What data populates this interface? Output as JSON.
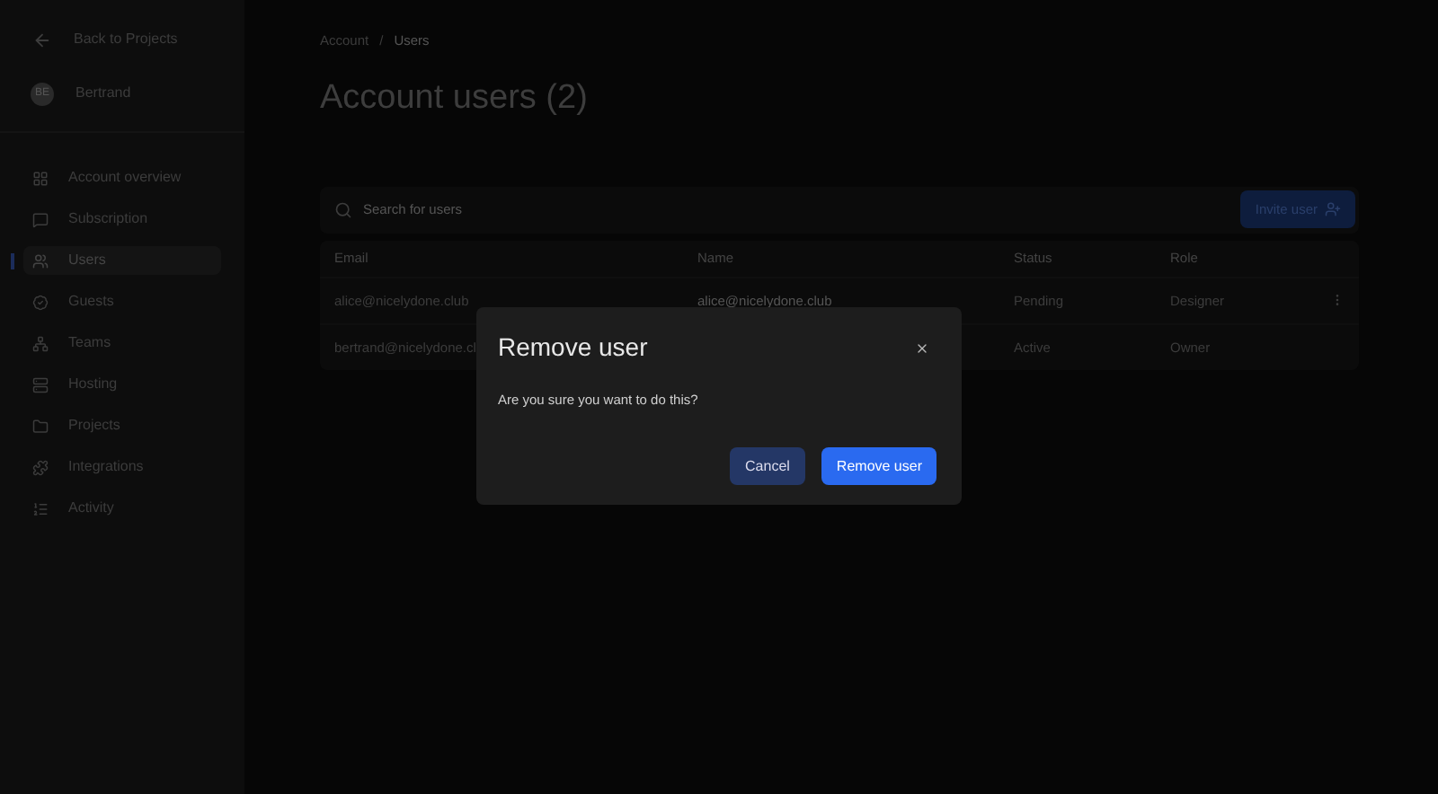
{
  "sidebar": {
    "back_link": "Back to Projects",
    "user": {
      "initials": "BE",
      "name": "Bertrand"
    },
    "items": [
      {
        "label": "Account overview",
        "selected": false
      },
      {
        "label": "Subscription",
        "selected": false
      },
      {
        "label": "Users",
        "selected": true
      },
      {
        "label": "Guests",
        "selected": false
      },
      {
        "label": "Teams",
        "selected": false
      },
      {
        "label": "Hosting",
        "selected": false
      },
      {
        "label": "Projects",
        "selected": false
      },
      {
        "label": "Integrations",
        "selected": false
      },
      {
        "label": "Activity",
        "selected": false
      }
    ]
  },
  "breadcrumb": {
    "items": [
      "Account",
      "Users"
    ],
    "separator": "/"
  },
  "title": "Account users (2)",
  "search": {
    "placeholder": "Search for users"
  },
  "invite_button": "Invite user",
  "table": {
    "columns": [
      "Email",
      "Name",
      "Status",
      "Role"
    ],
    "rows": [
      {
        "email": "alice@nicelydone.club",
        "name": "alice@nicelydone.club",
        "status": "Pending",
        "role": "Designer",
        "menu": true
      },
      {
        "email": "bertrand@nicelydone.cl",
        "status": "Active",
        "role": "Owner",
        "menu": false
      }
    ]
  },
  "dialog": {
    "title": "Remove user",
    "message": "Are you sure you want to do this?",
    "buttons": [
      {
        "label": "Cancel",
        "kind": "secondary"
      },
      {
        "label": "Remove user",
        "kind": "primary"
      }
    ]
  }
}
